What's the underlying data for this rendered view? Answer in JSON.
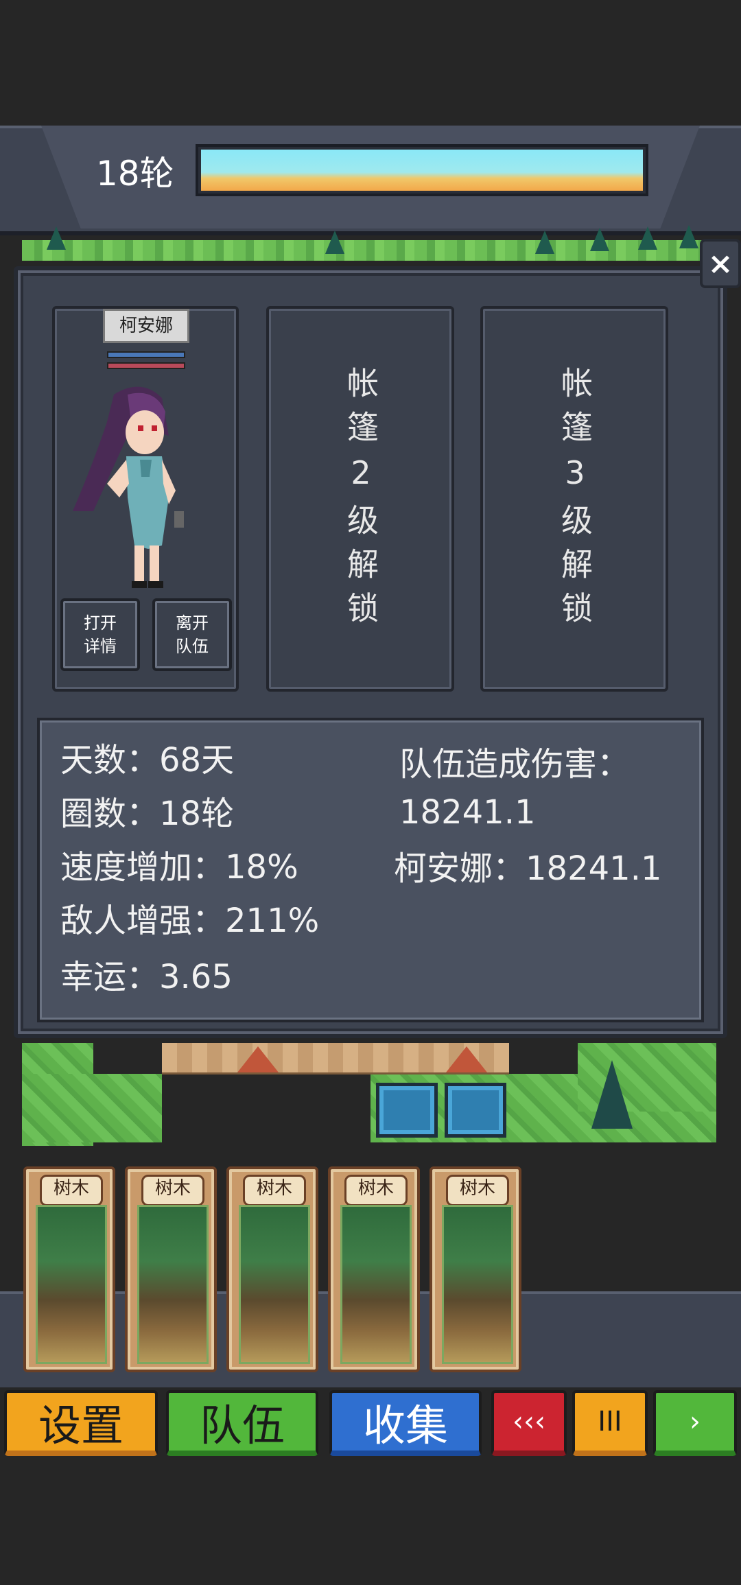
{
  "hud": {
    "round_label": "18轮"
  },
  "character_panel": {
    "close_label": "×",
    "character_name": "柯安娜",
    "open_details": "打开\n详情",
    "leave_team": "离开\n队伍",
    "slot2_text": "帐篷2级解锁",
    "slot3_text": "帐篷3级解锁"
  },
  "stats": {
    "days": "天数：68天",
    "rounds": "圈数：18轮",
    "speed": "速度增加：18%",
    "enemy": "敌人增强：211%",
    "luck": "幸运：3.65",
    "damage_title": "队伍造成伤害：",
    "damage_total": "18241.1",
    "member_damage": "柯安娜：18241.1"
  },
  "cards": [
    {
      "label": "树木"
    },
    {
      "label": "树木"
    },
    {
      "label": "树木"
    },
    {
      "label": "树木"
    },
    {
      "label": "树木"
    }
  ],
  "bottom_bar": {
    "settings": "设置",
    "team": "队伍",
    "collect": "收集",
    "rewind": "‹‹‹",
    "pause": "III",
    "next": "›"
  },
  "colors": {
    "panel": "#3d4350",
    "settings": "#f2a41e",
    "team": "#52b73b",
    "collect": "#2f6fd0",
    "rewind": "#cc2430"
  }
}
